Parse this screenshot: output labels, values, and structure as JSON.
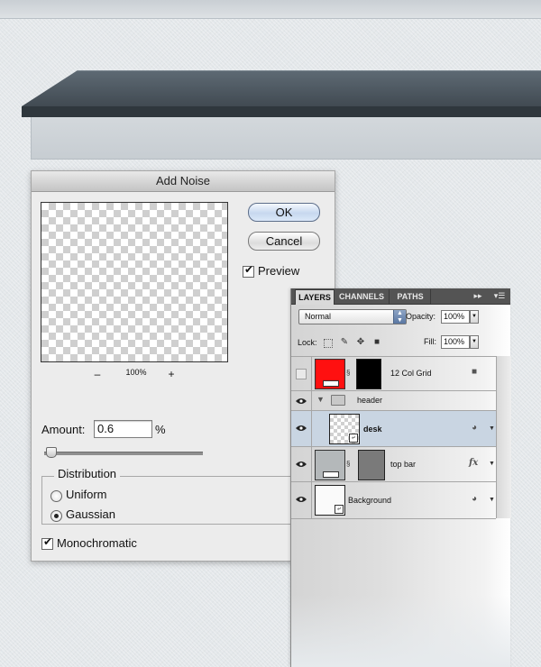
{
  "colors": {
    "bar_dark": "#414a52",
    "bar_light": "#5e6a74",
    "selected_layer": "#c9d5e2",
    "grid_red": "#ff1010",
    "top_bar_gray": "#7a7a7a"
  },
  "dialog": {
    "title": "Add Noise",
    "zoom_minus": "–",
    "zoom_plus": "+",
    "zoom_value": "100%",
    "ok_label": "OK",
    "cancel_label": "Cancel",
    "preview_label": "Preview",
    "preview_checked": true,
    "amount_label": "Amount:",
    "amount_value": "0.6",
    "amount_unit": "%",
    "amount_slider_fraction": 0.02,
    "distribution_title": "Distribution",
    "uniform_label": "Uniform",
    "gaussian_label": "Gaussian",
    "selected_distribution": "Gaussian",
    "monochromatic_label": "Monochromatic",
    "monochromatic_checked": true
  },
  "layers_panel": {
    "tabs": [
      "LAYERS",
      "CHANNELS",
      "PATHS"
    ],
    "active_tab": "LAYERS",
    "blend_mode": "Normal",
    "opacity_label": "Opacity:",
    "opacity_value": "100%",
    "lock_label": "Lock:",
    "fill_label": "Fill:",
    "fill_value": "100%",
    "layers": [
      {
        "name": "12 Col Grid",
        "visible": false,
        "icon": "lock-icon"
      },
      {
        "name": "header",
        "visible": true,
        "icon": "folder-icon"
      },
      {
        "name": "desk",
        "visible": true,
        "icon": "smart-object-icon",
        "selected": true
      },
      {
        "name": "top bar",
        "visible": true,
        "icon": "fx-icon"
      },
      {
        "name": "Background",
        "visible": true,
        "icon": "smart-object-icon"
      }
    ],
    "fx_symbol": "fx"
  }
}
